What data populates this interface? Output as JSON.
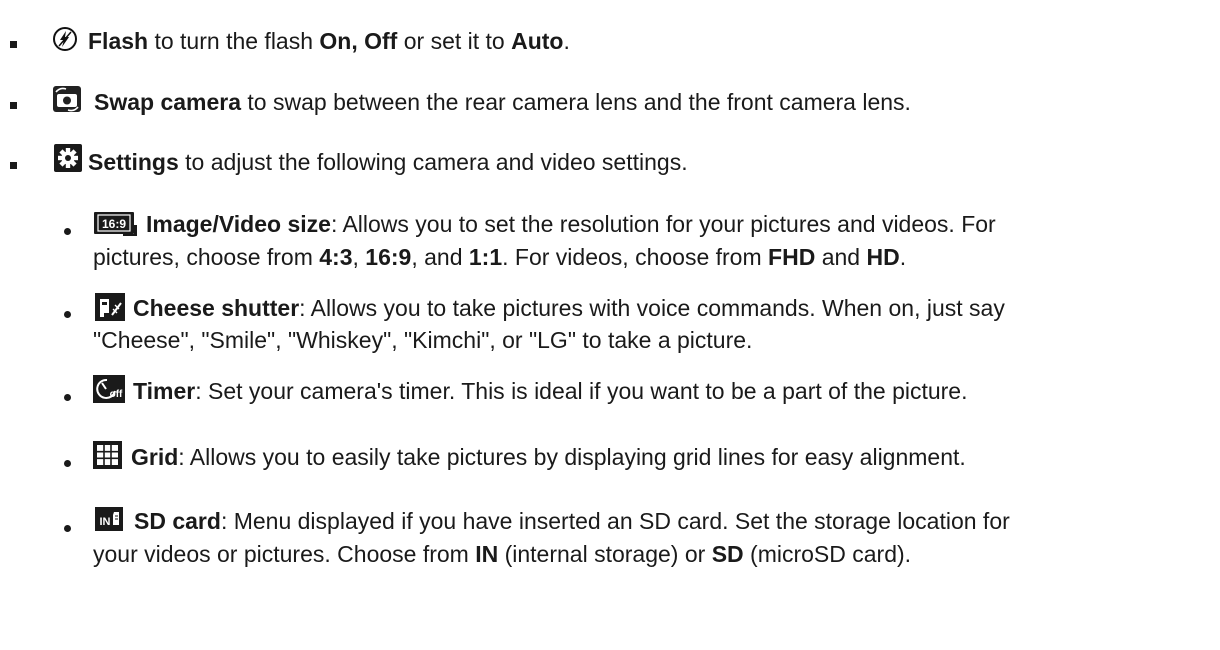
{
  "top_items": [
    {
      "icon": "flash-icon",
      "segments": [
        {
          "t": "Flash",
          "b": true
        },
        {
          "t": " to turn the flash ",
          "b": false
        },
        {
          "t": "On, Off",
          "b": true
        },
        {
          "t": " or set it to ",
          "b": false
        },
        {
          "t": "Auto",
          "b": true
        },
        {
          "t": ".",
          "b": false
        }
      ]
    },
    {
      "icon": "swap-camera-icon",
      "segments": [
        {
          "t": "Swap camera",
          "b": true
        },
        {
          "t": " to swap between the rear camera lens and the front camera lens.",
          "b": false
        }
      ]
    },
    {
      "icon": "settings-gear-icon",
      "segments": [
        {
          "t": "Settings",
          "b": true
        },
        {
          "t": " to adjust the following camera and video settings.",
          "b": false
        }
      ]
    }
  ],
  "sub_items": [
    {
      "icon": "image-video-size-icon",
      "icon_text": "16:9",
      "lines": [
        [
          {
            "t": "Image/Video size",
            "b": true
          },
          {
            "t": ": Allows you to set the resolution for your pictures and videos. For",
            "b": false
          }
        ],
        [
          {
            "t": "pictures, choose from ",
            "b": false
          },
          {
            "t": "4:3",
            "b": true
          },
          {
            "t": ", ",
            "b": false
          },
          {
            "t": "16:9",
            "b": true
          },
          {
            "t": ", and ",
            "b": false
          },
          {
            "t": "1:1",
            "b": true
          },
          {
            "t": ". For videos, choose from ",
            "b": false
          },
          {
            "t": "FHD",
            "b": true
          },
          {
            "t": " and ",
            "b": false
          },
          {
            "t": "HD",
            "b": true
          },
          {
            "t": ".",
            "b": false
          }
        ]
      ]
    },
    {
      "icon": "cheese-shutter-icon",
      "lines": [
        [
          {
            "t": "Cheese shutter",
            "b": true
          },
          {
            "t": ": Allows you to take pictures with voice commands. When on, just say",
            "b": false
          }
        ],
        [
          {
            "t": "\"Cheese\", \"Smile\", \"Whiskey\", \"Kimchi\", or \"LG\" to take a picture.",
            "b": false
          }
        ]
      ]
    },
    {
      "icon": "timer-off-icon",
      "icon_text": "off",
      "lines": [
        [
          {
            "t": "Timer",
            "b": true
          },
          {
            "t": ": Set your camera's timer. This is ideal if you want to be a part of the picture.",
            "b": false
          }
        ]
      ]
    },
    {
      "icon": "grid-icon",
      "lines": [
        [
          {
            "t": "Grid",
            "b": true
          },
          {
            "t": ": Allows you to easily take pictures by displaying grid lines for easy alignment.",
            "b": false
          }
        ]
      ]
    },
    {
      "icon": "sd-card-icon",
      "icon_text": "IN",
      "lines": [
        [
          {
            "t": "SD card",
            "b": true
          },
          {
            "t": ": Menu displayed if you have inserted an SD card. Set the storage location for",
            "b": false
          }
        ],
        [
          {
            "t": "your videos or pictures. Choose from ",
            "b": false
          },
          {
            "t": "IN",
            "b": true
          },
          {
            "t": " (internal storage) or ",
            "b": false
          },
          {
            "t": "SD",
            "b": true
          },
          {
            "t": " (microSD card).",
            "b": false
          }
        ]
      ]
    }
  ]
}
